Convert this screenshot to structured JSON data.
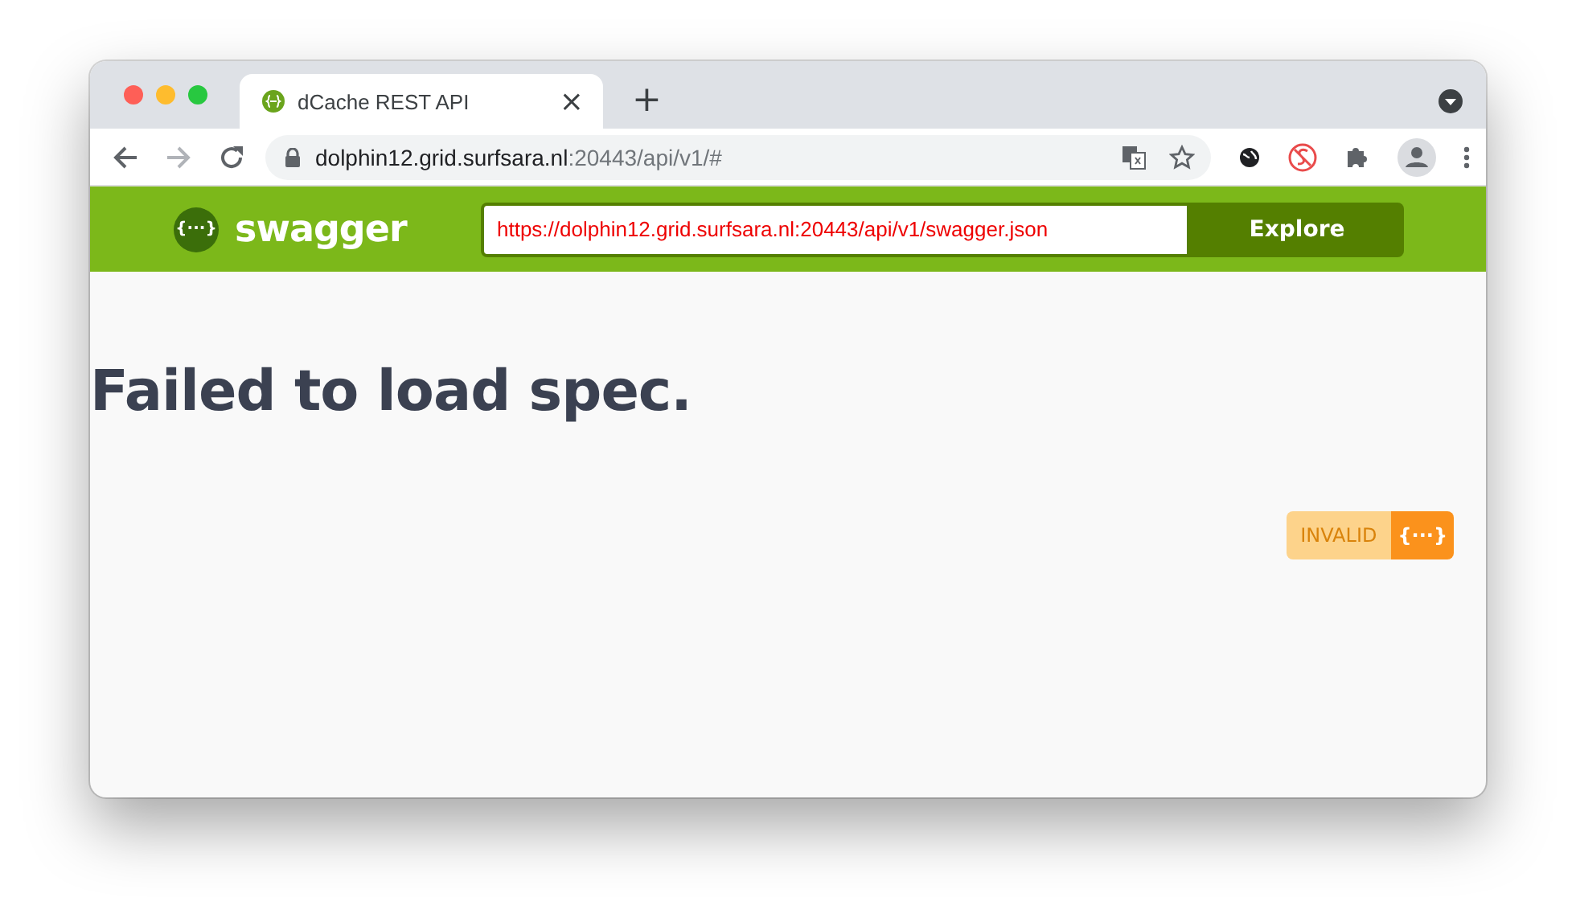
{
  "tabs": [
    {
      "title": "dCache REST API",
      "close": "×",
      "selected": true
    }
  ],
  "new_tab": "+",
  "address_bar": {
    "host": "dolphin12.grid.surfsara.nl",
    "path": ":20443/api/v1/#"
  },
  "swagger_bar": {
    "logo_glyph": "{···}",
    "logo_text": "swagger",
    "spec_url": "https://dolphin12.grid.surfsara.nl:20443/api/v1/swagger.json",
    "button": "Explore"
  },
  "error": {
    "message": "Failed to load spec."
  },
  "validator_badge": {
    "label": "INVALID",
    "glyph": "{···}"
  }
}
